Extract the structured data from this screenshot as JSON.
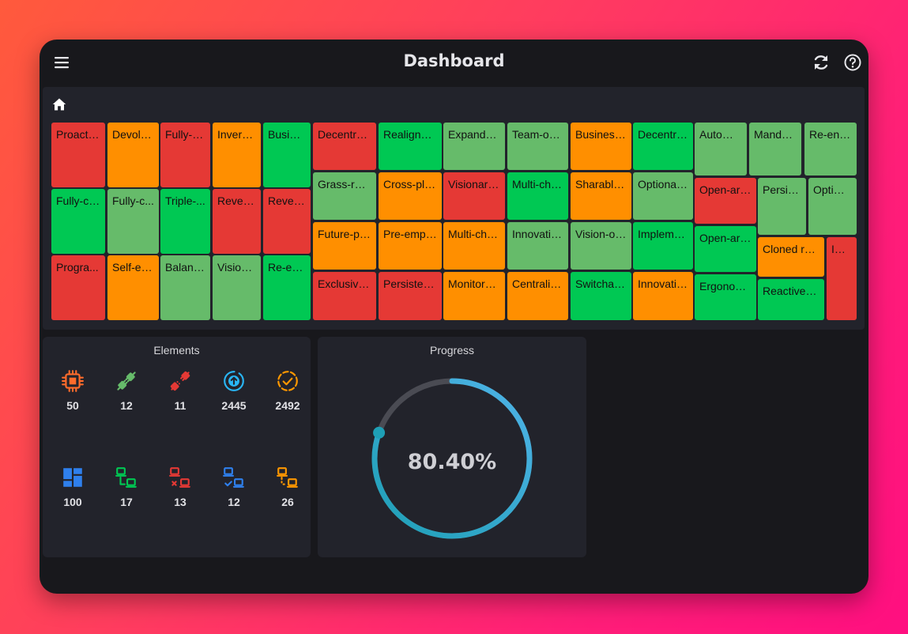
{
  "app": {
    "title": "Dashboard"
  },
  "toolbar": {
    "menu_icon": "menu-icon",
    "refresh_icon": "refresh-icon",
    "help_icon": "help-icon"
  },
  "breadcrumb": {
    "home_icon": "home-icon"
  },
  "treemap": {
    "cells": [
      {
        "label": "Proactiv...",
        "status": "red"
      },
      {
        "label": "Devolv...",
        "status": "orange"
      },
      {
        "label": "Fully-c...",
        "status": "red"
      },
      {
        "label": "Inverse...",
        "status": "orange"
      },
      {
        "label": "Busine...",
        "status": "green"
      },
      {
        "label": "Fully-co...",
        "status": "green"
      },
      {
        "label": "Fully-c...",
        "status": "light-green"
      },
      {
        "label": "Triple-...",
        "status": "green"
      },
      {
        "label": "Revers...",
        "status": "red"
      },
      {
        "label": "Revers...",
        "status": "red"
      },
      {
        "label": "Progra...",
        "status": "red"
      },
      {
        "label": "Self-en...",
        "status": "orange"
      },
      {
        "label": "Balanc...",
        "status": "light-green"
      },
      {
        "label": "Vision-...",
        "status": "light-green"
      },
      {
        "label": "Re-en...",
        "status": "green"
      },
      {
        "label": "Decentrali...",
        "status": "red"
      },
      {
        "label": "Realigned...",
        "status": "green"
      },
      {
        "label": "Expanded...",
        "status": "light-green"
      },
      {
        "label": "Team-ori...",
        "status": "light-green"
      },
      {
        "label": "Business-...",
        "status": "orange"
      },
      {
        "label": "Decentra...",
        "status": "green"
      },
      {
        "label": "Grass-roo...",
        "status": "light-green"
      },
      {
        "label": "Cross-pla...",
        "status": "orange"
      },
      {
        "label": "Visionary ...",
        "status": "red"
      },
      {
        "label": "Multi-cha...",
        "status": "green"
      },
      {
        "label": "Sharable ...",
        "status": "orange"
      },
      {
        "label": "Optional ...",
        "status": "light-green"
      },
      {
        "label": "Future-pr...",
        "status": "orange"
      },
      {
        "label": "Pre-empti...",
        "status": "orange"
      },
      {
        "label": "Multi-cha...",
        "status": "orange"
      },
      {
        "label": "Innovativ...",
        "status": "light-green"
      },
      {
        "label": "Vision-or...",
        "status": "light-green"
      },
      {
        "label": "Impleme...",
        "status": "green"
      },
      {
        "label": "Exclusive l...",
        "status": "red"
      },
      {
        "label": "Persistent...",
        "status": "red"
      },
      {
        "label": "Monitore...",
        "status": "orange"
      },
      {
        "label": "Centraliz...",
        "status": "orange"
      },
      {
        "label": "Switchab...",
        "status": "green"
      },
      {
        "label": "Innovativ...",
        "status": "orange"
      },
      {
        "label": "Automa...",
        "status": "light-green"
      },
      {
        "label": "Mandat...",
        "status": "light-green"
      },
      {
        "label": "Re-engi...",
        "status": "light-green"
      },
      {
        "label": "Open-arc...",
        "status": "red"
      },
      {
        "label": "Persist...",
        "status": "light-green"
      },
      {
        "label": "Optimi...",
        "status": "light-green"
      },
      {
        "label": "Open-arc...",
        "status": "green"
      },
      {
        "label": "Cloned ro...",
        "status": "orange"
      },
      {
        "label": "Im...",
        "status": "red"
      },
      {
        "label": "Ergonom...",
        "status": "green"
      },
      {
        "label": "Reactive h...",
        "status": "green"
      }
    ]
  },
  "elements": {
    "title": "Elements",
    "stats": [
      {
        "icon": "chip-icon",
        "value": "50",
        "color": "#ff6b2b"
      },
      {
        "icon": "plug-connected-icon",
        "value": "12",
        "color": "#66bb6a"
      },
      {
        "icon": "plug-disconnected-icon",
        "value": "11",
        "color": "#e53935"
      },
      {
        "icon": "arrow-up-circle-icon",
        "value": "2445",
        "color": "#29b6f6"
      },
      {
        "icon": "check-circle-dashed-icon",
        "value": "2492",
        "color": "#ff9800"
      },
      {
        "icon": "dashboard-grid-icon",
        "value": "100",
        "color": "#2f80ed"
      },
      {
        "icon": "network-icon",
        "value": "17",
        "color": "#00c853"
      },
      {
        "icon": "network-x-icon",
        "value": "13",
        "color": "#e53935"
      },
      {
        "icon": "network-check-icon",
        "value": "12",
        "color": "#2f80ed"
      },
      {
        "icon": "network-pending-icon",
        "value": "26",
        "color": "#ff9800"
      }
    ]
  },
  "progress": {
    "title": "Progress",
    "value_text": "80.40%",
    "fraction": 0.804,
    "colors": {
      "track": "#4a4b53",
      "start": "#1e9fb5",
      "end": "#4fb3e8"
    }
  },
  "colors": {
    "green": "#00c853",
    "light-green": "#66bb6a",
    "orange": "#ff8f00",
    "red": "#e53935"
  }
}
